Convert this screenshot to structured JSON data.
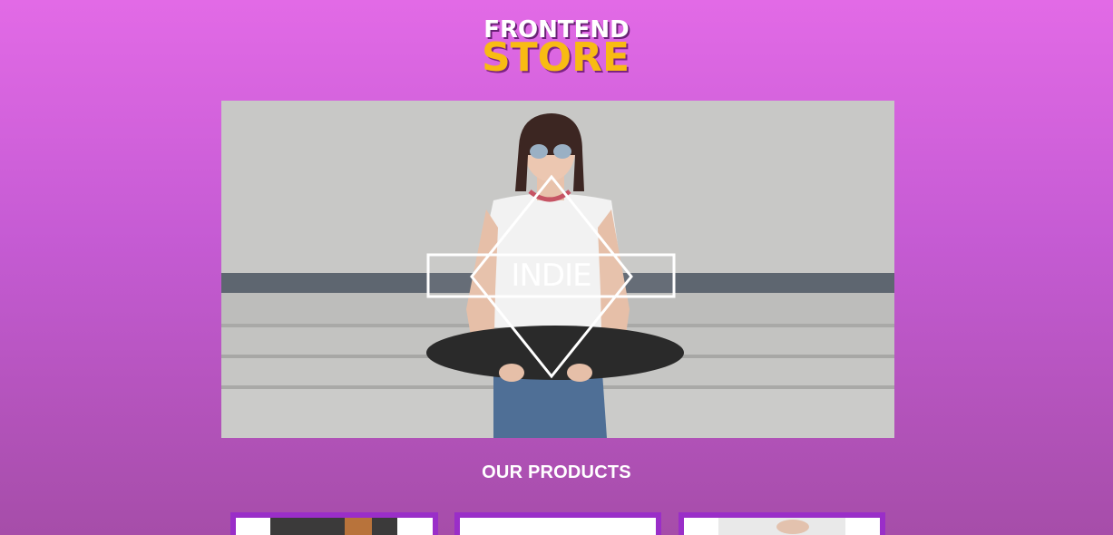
{
  "header": {
    "logo_line1": "FRONTEND",
    "logo_line2": "STORE"
  },
  "hero": {
    "badge_text": "INDIE"
  },
  "products": {
    "title": "OUR PRODUCTS",
    "items": [
      {
        "image_icon": "product-photo"
      },
      {
        "image_icon": "product-photo"
      },
      {
        "image_icon": "product-photo"
      }
    ]
  },
  "colors": {
    "background_top": "#e26ae6",
    "background_bottom": "#a64da9",
    "logo_white": "#ffffff",
    "logo_yellow": "#f8bb13",
    "card_border": "#9a2ec8"
  }
}
